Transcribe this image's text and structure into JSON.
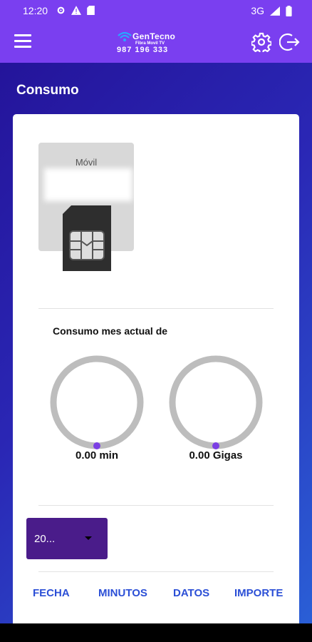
{
  "status_bar": {
    "time": "12:20",
    "network": "3G",
    "icons": [
      "gear-icon",
      "warning-icon",
      "sd-card-icon",
      "signal-icon",
      "battery-icon"
    ]
  },
  "app_bar": {
    "logo": {
      "title": "GenTecno",
      "subtitle": "Fibra Movil TV",
      "phone": "987 196 333"
    },
    "icons": [
      "menu-icon",
      "gear-icon",
      "logout-icon"
    ]
  },
  "page": {
    "title": "Consumo",
    "sim_label": "Móvil",
    "consumption_label": "Consumo mes actual de",
    "gauges": [
      {
        "value_text": "0.00 min",
        "fraction": 0
      },
      {
        "value_text": "0.00 Gigas",
        "fraction": 0
      }
    ],
    "year_select": {
      "value": "20..."
    },
    "table_headers": [
      "FECHA",
      "MINUTOS",
      "DATOS",
      "IMPORTE"
    ]
  },
  "colors": {
    "app_bar": "#7a3ff0",
    "accent": "#4a1c8a",
    "gauge_track": "#bdbdbd",
    "gauge_dot": "#7b3fe4",
    "header_link": "#2b4fd6"
  }
}
